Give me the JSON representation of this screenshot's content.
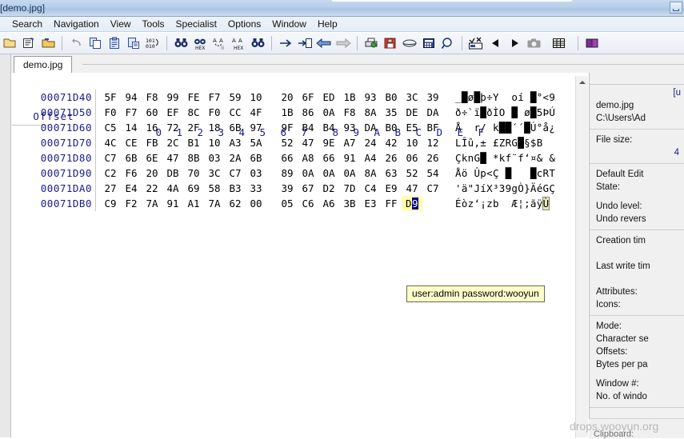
{
  "window": {
    "title": "[demo.jpg]",
    "restore_button": "restore-down"
  },
  "menubar": {
    "items": [
      {
        "label": "Search"
      },
      {
        "label": "Navigation"
      },
      {
        "label": "View"
      },
      {
        "label": "Tools"
      },
      {
        "label": "Specialist"
      },
      {
        "label": "Options"
      },
      {
        "label": "Window"
      },
      {
        "label": "Help"
      }
    ]
  },
  "toolbar": {
    "groups": [
      [
        "open-file-icon",
        "properties-icon",
        "open-folder-icon"
      ],
      [
        "undo-icon",
        "copy-icon",
        "clipboard-icon",
        "paste-icon",
        "binary-101-icon"
      ],
      [
        "find-icon",
        "find-hex-icon",
        "replace-icon",
        "replace-hex-icon",
        "find-all-icon"
      ],
      [
        "goto-right-icon",
        "goto-offset-icon",
        "back-arrow-icon",
        "forward-arrow-icon"
      ],
      [
        "print-icon",
        "save-icon",
        "disk-icon",
        "calculator-icon",
        "zoom-icon"
      ],
      [
        "checksum-icon",
        "play-back-icon",
        "play-forward-icon",
        "camera-icon"
      ],
      [
        "table-icon"
      ],
      [
        "book-icon"
      ]
    ]
  },
  "tabs": {
    "active": "demo.jpg",
    "items": [
      {
        "label": "demo.jpg"
      }
    ]
  },
  "hex": {
    "header": {
      "offset_label": "Offset",
      "columns": [
        "0",
        "1",
        "2",
        "3",
        "4",
        "5",
        "6",
        "7",
        "8",
        "9",
        "A",
        "B",
        "C",
        "D",
        "E",
        "F"
      ]
    },
    "rows": [
      {
        "offset": "00071D40",
        "bytes": [
          "5F",
          "94",
          "F8",
          "99",
          "FE",
          "F7",
          "59",
          "10",
          "20",
          "6F",
          "ED",
          "1B",
          "93",
          "B0",
          "3C",
          "39"
        ],
        "ascii": "_█ø█þ÷Y  oí █°<9"
      },
      {
        "offset": "00071D50",
        "bytes": [
          "F0",
          "F7",
          "60",
          "EF",
          "8C",
          "F0",
          "CC",
          "4F",
          "1B",
          "86",
          "0A",
          "F8",
          "8A",
          "35",
          "DE",
          "DA"
        ],
        "ascii": "ð÷`ï█ðÌO █ ø█5ÞÚ"
      },
      {
        "offset": "00071D60",
        "bytes": [
          "C5",
          "14",
          "16",
          "72",
          "2F",
          "18",
          "6B",
          "97",
          "9F",
          "B4",
          "B4",
          "93",
          "DA",
          "B0",
          "E5",
          "BF"
        ],
        "ascii": "Å  r/ k██´´█Ú°å¿"
      },
      {
        "offset": "00071D70",
        "bytes": [
          "4C",
          "CE",
          "FB",
          "2C",
          "B1",
          "10",
          "A3",
          "5A",
          "52",
          "47",
          "9E",
          "A7",
          "24",
          "42",
          "10",
          "12"
        ],
        "ascii": "LÎû,± £ZRG█§$B"
      },
      {
        "offset": "00071D80",
        "bytes": [
          "C7",
          "6B",
          "6E",
          "47",
          "8B",
          "03",
          "2A",
          "6B",
          "66",
          "A8",
          "66",
          "91",
          "A4",
          "26",
          "06",
          "26"
        ],
        "ascii": "ÇknG█ *kf¨f‘¤& &"
      },
      {
        "offset": "00071D90",
        "bytes": [
          "C2",
          "F6",
          "20",
          "DB",
          "70",
          "3C",
          "C7",
          "03",
          "89",
          "0A",
          "0A",
          "0A",
          "8A",
          "63",
          "52",
          "54"
        ],
        "ascii": "Åö Ûp<Ç █   █cRT"
      },
      {
        "offset": "00071DA0",
        "bytes": [
          "27",
          "E4",
          "22",
          "4A",
          "69",
          "58",
          "B3",
          "33",
          "39",
          "67",
          "D2",
          "7D",
          "C4",
          "E9",
          "47",
          "C7"
        ],
        "ascii": "'ä\"JíX³39gÒ}ÄéGÇ"
      },
      {
        "offset": "00071DB0",
        "bytes": [
          "C9",
          "F2",
          "7A",
          "91",
          "A1",
          "7A",
          "62",
          "00",
          "05",
          "C6",
          "A6",
          "3B",
          "E3",
          "FF",
          "D9",
          ""
        ],
        "ascii": "Éòz‘¡zb  Æ¦;ãÿÙ"
      }
    ],
    "cursor": {
      "row_index": 7,
      "byte_index": 14,
      "byte_value": "D9",
      "selected_nibble": "9",
      "highlight_color": "#ffffb0",
      "caret_color": "#000080"
    }
  },
  "tooltip": {
    "text": "user:admin password:wooyun"
  },
  "info_panel": {
    "link_line": "[u",
    "file_name": "demo.jpg",
    "file_path": "C:\\Users\\Ad",
    "sections": [
      {
        "label": "File size:",
        "value": "4"
      },
      {
        "label": "Default Edit",
        "value": ""
      },
      {
        "label": "State:",
        "value": ""
      },
      {
        "label": "Undo level:",
        "value": ""
      },
      {
        "label": "Undo revers",
        "value": ""
      },
      {
        "label": "Creation tim",
        "value": ""
      },
      {
        "label": "Last write tim",
        "value": ""
      },
      {
        "label": "Attributes:",
        "value": ""
      },
      {
        "label": "Icons:",
        "value": ""
      },
      {
        "label": "Mode:",
        "value": ""
      },
      {
        "label": "Character se",
        "value": ""
      },
      {
        "label": "Offsets:",
        "value": ""
      },
      {
        "label": "Bytes per pa",
        "value": ""
      },
      {
        "label": "Window #:",
        "value": ""
      },
      {
        "label": "No. of windo",
        "value": ""
      }
    ],
    "clipboard_label": "Clipboard:"
  },
  "watermark": {
    "text": "drops.wooyun.org"
  }
}
